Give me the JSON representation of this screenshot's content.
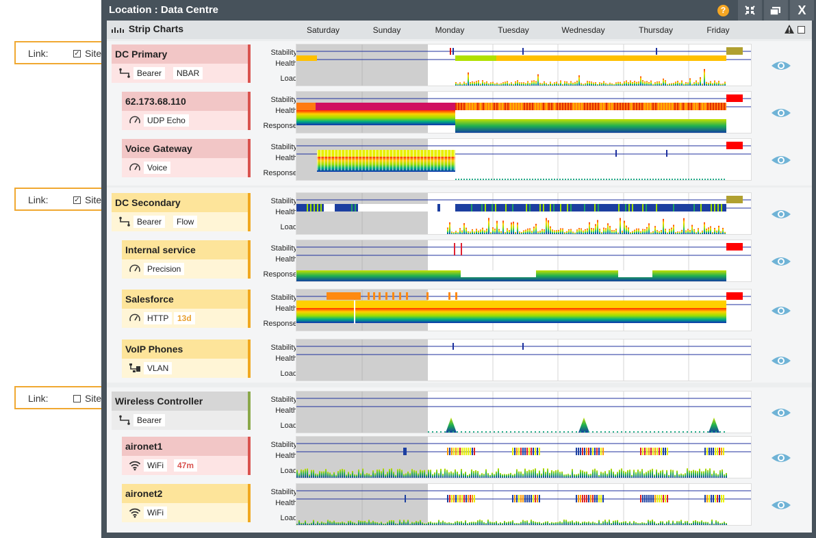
{
  "window": {
    "title": "Location : Data Centre",
    "help_icon": "?",
    "buttons": [
      "compress-icon",
      "restore-icon",
      "close-icon"
    ],
    "close_label": "X"
  },
  "strip": {
    "title": "Strip Charts",
    "days": [
      "Saturday",
      "Sunday",
      "Monday",
      "Tuesday",
      "Wednesday",
      "Thursday",
      "Friday"
    ]
  },
  "links": [
    {
      "label": "Link:",
      "checked": true,
      "site": "Site"
    },
    {
      "label": "Link:",
      "checked": true,
      "site": "Site"
    },
    {
      "label": "Link:",
      "checked": false,
      "site": "Site"
    }
  ],
  "colors": {
    "red_bar": "#d9534f",
    "amber_bar": "#f0a820",
    "green_bar": "#8aa84a",
    "pink_card": "#f2c6c6",
    "pink_sub": "#fde4e4",
    "yellow_card": "#fde49a",
    "yellow_sub": "#fff5d6",
    "grey_card": "#d6d6d6",
    "grey_sub": "#ececec"
  },
  "rows": [
    {
      "name": "DC Primary",
      "icon": "bearer-icon",
      "tags": [
        "Bearer",
        "NBAR"
      ],
      "status": "red",
      "labels": [
        "Stability",
        "Health",
        "Load"
      ],
      "indent": false
    },
    {
      "name": "62.173.68.110",
      "icon": "gauge-icon",
      "tags": [
        "UDP Echo"
      ],
      "status": "red",
      "labels": [
        "Stability",
        "Health",
        "Response"
      ],
      "indent": true
    },
    {
      "name": "Voice Gateway",
      "icon": "gauge-icon",
      "tags": [
        "Voice"
      ],
      "status": "red",
      "labels": [
        "Stability",
        "Health",
        "Response"
      ],
      "indent": true
    },
    {
      "name": "DC Secondary",
      "icon": "bearer-icon",
      "tags": [
        "Bearer",
        "Flow"
      ],
      "status": "amber",
      "labels": [
        "Stability",
        "Health",
        "Load"
      ],
      "indent": false
    },
    {
      "name": "Internal service",
      "icon": "gauge-icon",
      "tags": [
        "Precision"
      ],
      "status": "amber",
      "labels": [
        "Stability",
        "Health",
        "Response"
      ],
      "indent": true
    },
    {
      "name": "Salesforce",
      "icon": "gauge-icon",
      "tags": [
        "HTTP"
      ],
      "time": "13d",
      "status": "amber",
      "labels": [
        "Stability",
        "Health",
        "Response"
      ],
      "indent": true
    },
    {
      "name": "VoIP Phones",
      "icon": "vlan-icon",
      "tags": [
        "VLAN"
      ],
      "status": "amber",
      "labels": [
        "Stability",
        "Health",
        "Load"
      ],
      "indent": true
    },
    {
      "name": "Wireless Controller",
      "icon": "bearer-icon",
      "tags": [
        "Bearer"
      ],
      "status": "green",
      "labels": [
        "Stability",
        "Health",
        "Load"
      ],
      "indent": false
    },
    {
      "name": "aironet1",
      "icon": "wifi-icon",
      "tags": [
        "WiFi"
      ],
      "time": "47m",
      "status": "red",
      "labels": [
        "Stability",
        "Health",
        "Load"
      ],
      "indent": true
    },
    {
      "name": "aironet2",
      "icon": "wifi-icon",
      "tags": [
        "WiFi"
      ],
      "status": "amber",
      "labels": [
        "Stability",
        "Health",
        "Load"
      ],
      "indent": true
    }
  ]
}
